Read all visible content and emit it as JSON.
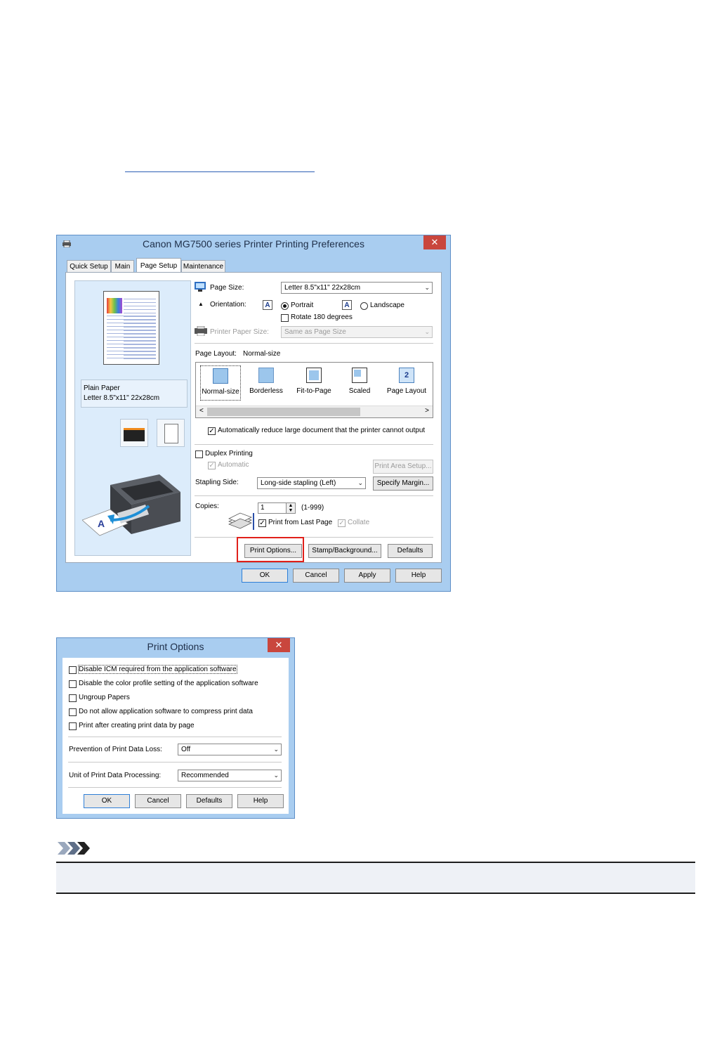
{
  "main_dialog": {
    "title": "Canon MG7500 series Printer Printing Preferences",
    "close_glyph": "✕",
    "tabs": [
      {
        "label": "Quick Setup"
      },
      {
        "label": "Main"
      },
      {
        "label": "Page Setup"
      },
      {
        "label": "Maintenance"
      }
    ],
    "page_size": {
      "label": "Page Size:",
      "value": "Letter 8.5\"x11\" 22x28cm"
    },
    "orientation": {
      "label": "Orientation:",
      "portrait": "Portrait",
      "landscape": "Landscape",
      "orientation_glyph": "A",
      "selected": "Portrait",
      "rotate_label": "Rotate 180 degrees",
      "rotate_checked": false
    },
    "printer_paper_size": {
      "label": "Printer Paper Size:",
      "value": "Same as Page Size"
    },
    "page_layout": {
      "label": "Page Layout:",
      "value": "Normal-size",
      "items": [
        {
          "label": "Normal-size",
          "icon": "normal-size-icon"
        },
        {
          "label": "Borderless",
          "icon": "borderless-icon"
        },
        {
          "label": "Fit-to-Page",
          "icon": "fit-to-page-icon"
        },
        {
          "label": "Scaled",
          "icon": "scaled-icon"
        },
        {
          "label": "Page Layout",
          "icon": "page-layout-icon",
          "glyph": "2"
        }
      ],
      "scroll_left": "<",
      "scroll_right": ">"
    },
    "auto_reduce": {
      "label": "Automatically reduce large document that the printer cannot output",
      "checked": true
    },
    "duplex": {
      "label": "Duplex Printing",
      "checked": false
    },
    "automatic": {
      "label": "Automatic",
      "checked": true
    },
    "print_area_setup": "Print Area Setup...",
    "stapling": {
      "label": "Stapling Side:",
      "value": "Long-side stapling (Left)"
    },
    "specify_margin": "Specify Margin...",
    "copies": {
      "label": "Copies:",
      "value": "1",
      "range": "(1-999)"
    },
    "print_from_last_page": {
      "label": "Print from Last Page",
      "checked": true
    },
    "collate": {
      "label": "Collate",
      "checked": true
    },
    "preview": {
      "paper_type": "Plain Paper",
      "paper_size": "Letter 8.5\"x11\" 22x28cm"
    },
    "buttons": {
      "print_options": "Print Options...",
      "stamp_background": "Stamp/Background...",
      "defaults": "Defaults",
      "ok": "OK",
      "cancel": "Cancel",
      "apply": "Apply",
      "help": "Help"
    },
    "arrow_glyph": "⌄",
    "check_glyph": "✓"
  },
  "print_options_dialog": {
    "title": "Print Options",
    "close_glyph": "✕",
    "checkboxes": [
      {
        "label": "Disable ICM required from the application software",
        "checked": false
      },
      {
        "label": "Disable the color profile setting of the application software",
        "checked": false
      },
      {
        "label": "Ungroup Papers",
        "checked": false
      },
      {
        "label": "Do not allow application software to compress print data",
        "checked": false
      },
      {
        "label": "Print after creating print data by page",
        "checked": false
      }
    ],
    "prevention": {
      "label": "Prevention of Print Data Loss:",
      "value": "Off"
    },
    "unit": {
      "label": "Unit of Print Data Processing:",
      "value": "Recommended"
    },
    "buttons": {
      "ok": "OK",
      "cancel": "Cancel",
      "defaults": "Defaults",
      "help": "Help"
    }
  },
  "colors": {
    "dialog_bg": "#a9cdf0",
    "highlight": "#e0201b",
    "close": "#c9463d"
  }
}
